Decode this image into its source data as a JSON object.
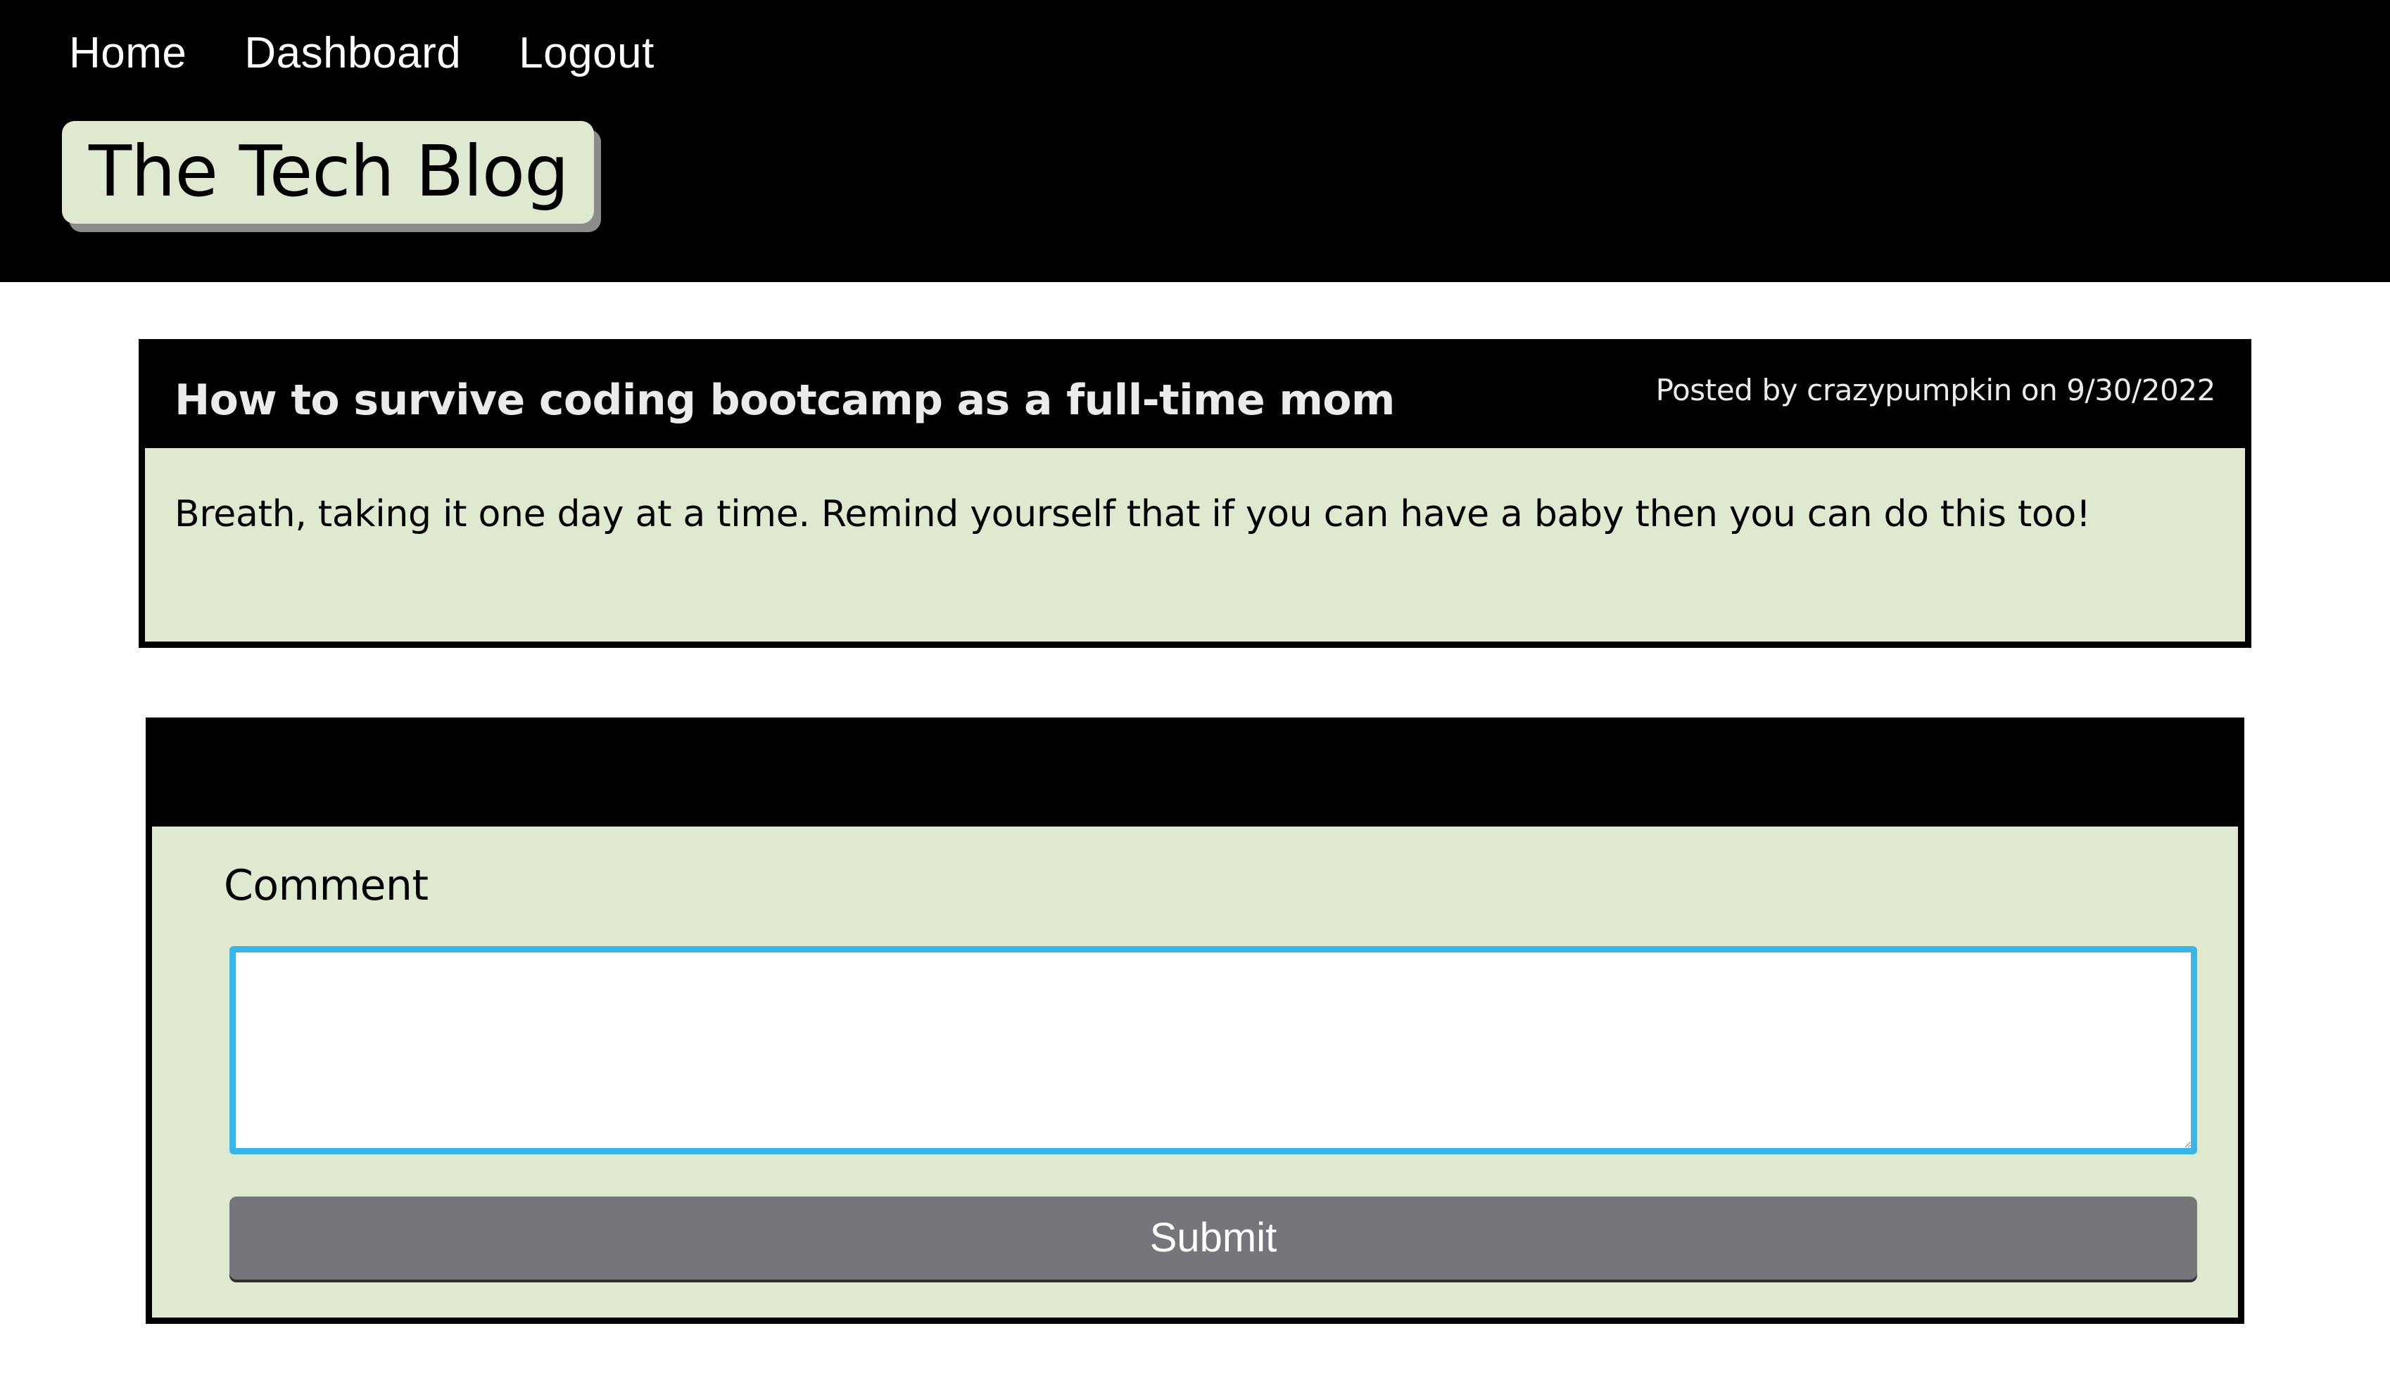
{
  "nav": {
    "items": [
      {
        "label": "Home"
      },
      {
        "label": "Dashboard"
      },
      {
        "label": "Logout"
      }
    ]
  },
  "site": {
    "title": "The Tech Blog"
  },
  "post": {
    "title": "How to survive coding bootcamp as a full-time mom",
    "meta": "Posted by crazypumpkin on 9/30/2022",
    "body": "Breath, taking it one day at a time. Remind yourself that if you can have a baby then you can do this too!"
  },
  "comment_form": {
    "label": "Comment",
    "value": "",
    "submit_label": "Submit"
  },
  "colors": {
    "header_bg": "#000000",
    "card_bg": "#dfe9cf",
    "focus_border": "#3bb5e8",
    "button_bg": "#74767b"
  }
}
